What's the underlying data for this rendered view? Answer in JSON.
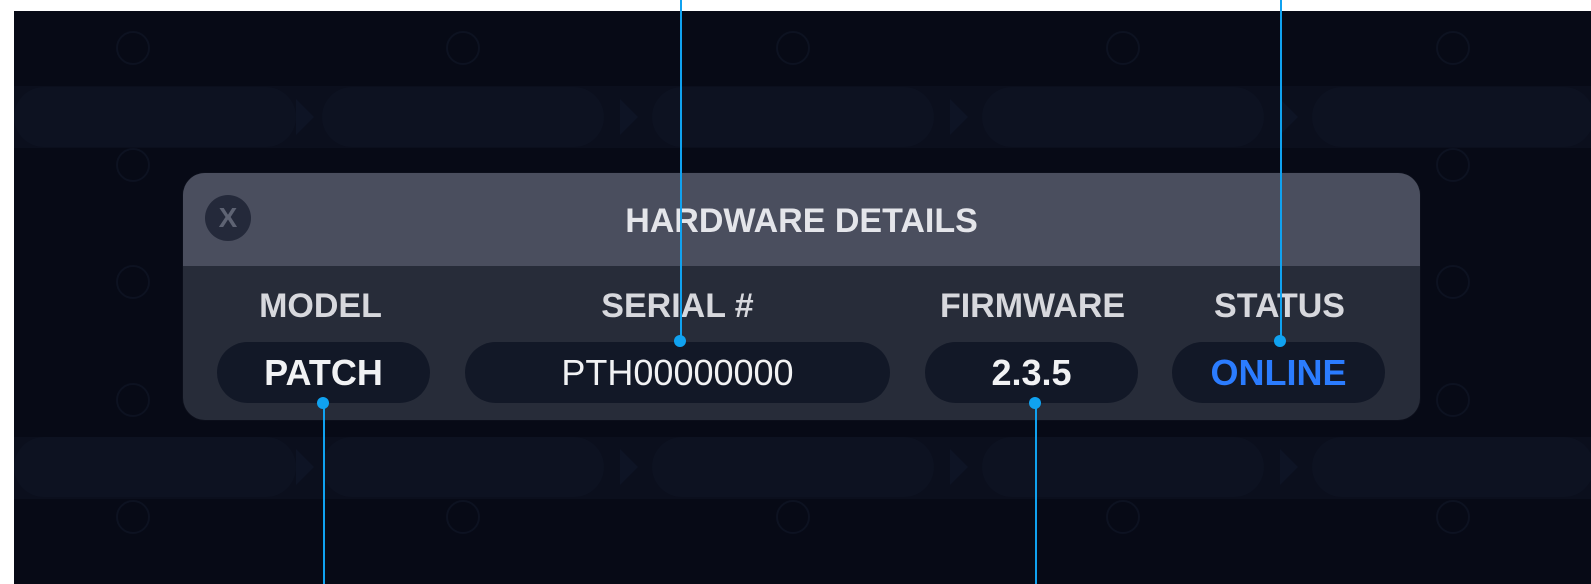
{
  "dialog": {
    "title": "HARDWARE DETAILS",
    "close_label": "X",
    "fields": [
      {
        "label": "MODEL",
        "value": "PATCH"
      },
      {
        "label": "SERIAL #",
        "value": "PTH00000000"
      },
      {
        "label": "FIRMWARE",
        "value": "2.3.5"
      },
      {
        "label": "STATUS",
        "value": "ONLINE"
      }
    ]
  },
  "colors": {
    "accent": "#2B7CFF",
    "callout": "#10A2F0",
    "panel_header": "#4A4E5E",
    "panel_body": "#272C39",
    "value_pill": "#121827",
    "background": "#070A16"
  },
  "icons": {
    "close": "close-icon",
    "callout_marker": "callout-dot"
  }
}
